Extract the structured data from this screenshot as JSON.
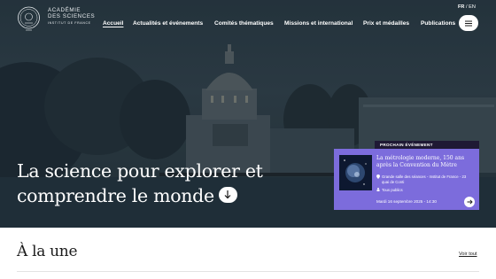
{
  "brand": {
    "line1": "ACADÉMIE",
    "line2": "DES SCIENCES",
    "line3": "INSTITUT DE FRANCE",
    "logo_icon": "academie-seal-icon"
  },
  "nav": {
    "items": [
      {
        "label": "Accueil",
        "active": true
      },
      {
        "label": "Actualités et événements"
      },
      {
        "label": "Comités thématiques"
      },
      {
        "label": "Missions et international"
      },
      {
        "label": "Prix et médailles"
      },
      {
        "label": "Publications"
      }
    ]
  },
  "lang": {
    "fr": "FR",
    "separator": "/",
    "en": "EN"
  },
  "menu_button": {
    "icon": "hamburger-icon"
  },
  "hero": {
    "headline_line1": "La science pour explorer et",
    "headline_line2": "comprendre le monde",
    "down_icon": "arrow-down-icon"
  },
  "event": {
    "tab_label": "PROCHAIN ÉVÉNEMENT",
    "title": "La métrologie moderne, 150 ans après la Convention du Mètre",
    "location": "Grande salle des séances - Institut de France - 23 quai de Conti",
    "audience": "Tous publics",
    "date": "Mardi 16 septembre 2025 - 14:30",
    "arrow_icon": "arrow-right-icon"
  },
  "section": {
    "title": "À la une",
    "link": "Voir tout"
  },
  "colors": {
    "event_card": "#7c6cdc",
    "event_tab": "#1f1934",
    "hero_overlay": "#24323b"
  }
}
